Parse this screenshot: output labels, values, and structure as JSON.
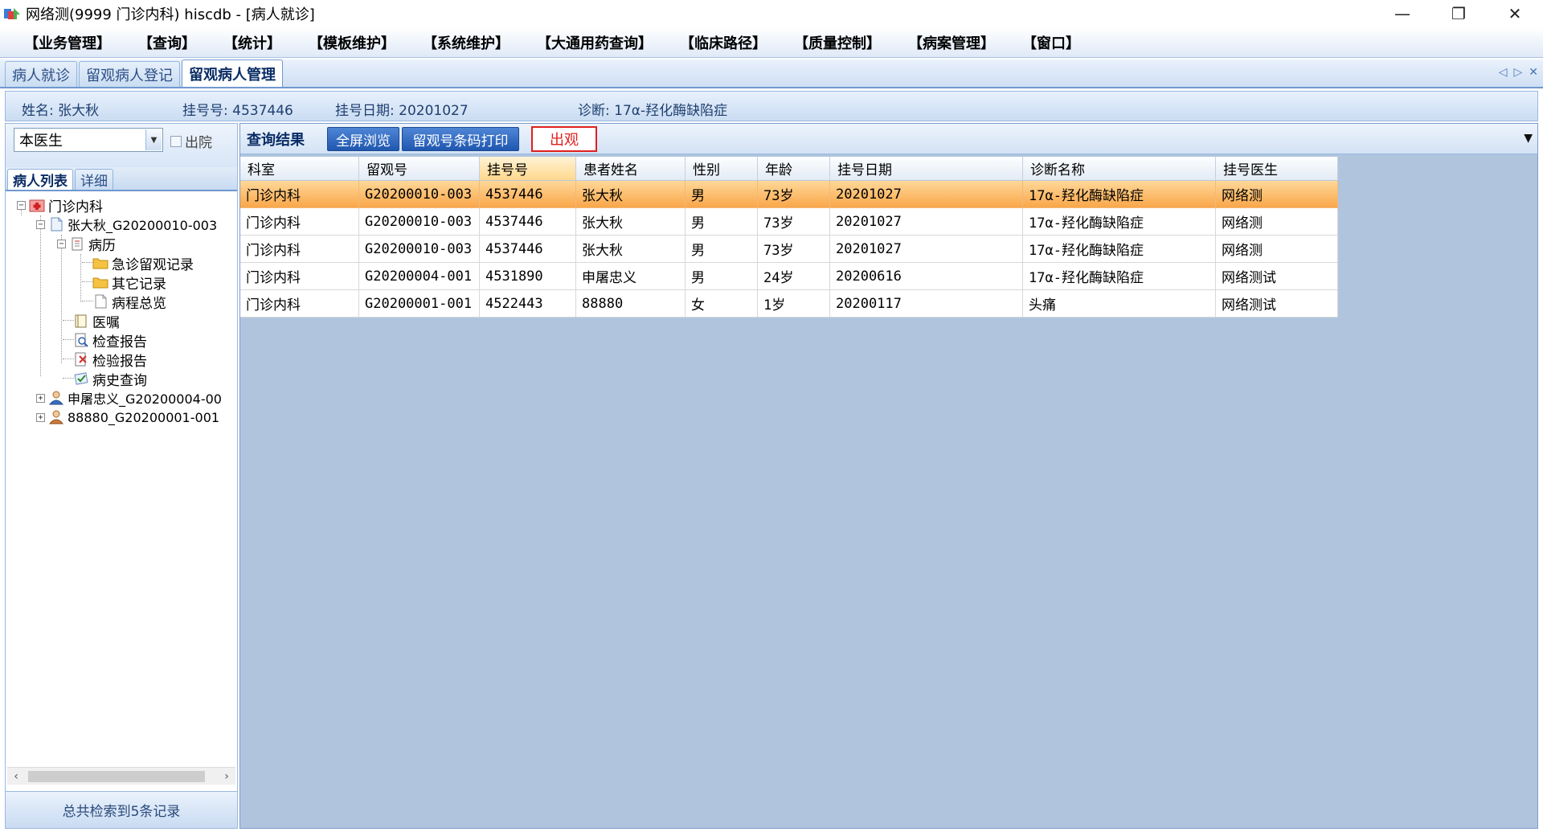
{
  "window": {
    "title": "网络测(9999 门诊内科)  hiscdb - [病人就诊]",
    "minimize": "—",
    "restore": "❐",
    "close": "✕"
  },
  "menu": [
    "【业务管理】",
    "【查询】",
    "【统计】",
    "【模板维护】",
    "【系统维护】",
    "【大通用药查询】",
    "【临床路径】",
    "【质量控制】",
    "【病案管理】",
    "【窗口】"
  ],
  "tabs": [
    {
      "label": "病人就诊",
      "active": false
    },
    {
      "label": "留观病人登记",
      "active": false
    },
    {
      "label": "留观病人管理",
      "active": true
    }
  ],
  "tab_nav": {
    "prev": "◁",
    "next": "▷",
    "close": "✕"
  },
  "patient_info": {
    "name": "姓名: 张大秋",
    "reg_no": "挂号号: 4537446",
    "reg_date": "挂号日期: 20201027",
    "diagnosis": "诊断: 17α-羟化酶缺陷症"
  },
  "left_panel": {
    "doctor_filter": "本医生",
    "discharge_label": "出院",
    "subtabs": [
      {
        "label": "病人列表",
        "active": true
      },
      {
        "label": "详细",
        "active": false
      }
    ],
    "tree": {
      "dept": "门诊内科",
      "patient1": "张大秋_G20200010-003",
      "records": "病历",
      "er_obs": "急诊留观记录",
      "other": "其它记录",
      "overview": "病程总览",
      "orders": "医嘱",
      "exam": "检查报告",
      "lab": "检验报告",
      "history": "病史查询",
      "patient2": "申屠忠义_G20200004-00",
      "patient3": "88880_G20200001-001"
    },
    "status": "总共检索到5条记录"
  },
  "toolbar": {
    "label": "查询结果",
    "fullscreen": "全屏浏览",
    "barcode_print": "留观号条码打印",
    "discharge_obs": "出观",
    "more": "▼"
  },
  "grid": {
    "columns": [
      "科室",
      "留观号",
      "挂号号",
      "患者姓名",
      "性别",
      "年龄",
      "挂号日期",
      "诊断名称",
      "挂号医生"
    ],
    "rows": [
      [
        "门诊内科",
        "G20200010-003",
        "4537446",
        "张大秋",
        "男",
        "73岁",
        "20201027",
        "17α-羟化酶缺陷症",
        "网络测"
      ],
      [
        "门诊内科",
        "G20200010-003",
        "4537446",
        "张大秋",
        "男",
        "73岁",
        "20201027",
        "17α-羟化酶缺陷症",
        "网络测"
      ],
      [
        "门诊内科",
        "G20200010-003",
        "4537446",
        "张大秋",
        "男",
        "73岁",
        "20201027",
        "17α-羟化酶缺陷症",
        "网络测"
      ],
      [
        "门诊内科",
        "G20200004-001",
        "4531890",
        "申屠忠义",
        "男",
        "24岁",
        "20200616",
        "17α-羟化酶缺陷症",
        "网络测试"
      ],
      [
        "门诊内科",
        "G20200001-001",
        "4522443",
        "88880",
        "女",
        "1岁",
        "20200117",
        "头痛",
        "网络测试"
      ]
    ]
  },
  "colors": {
    "selected_row": "#f9a547",
    "toolbar_button": "#1f57b0",
    "discharge_button": "#e0201e",
    "grid_background": "#b0c4de"
  }
}
